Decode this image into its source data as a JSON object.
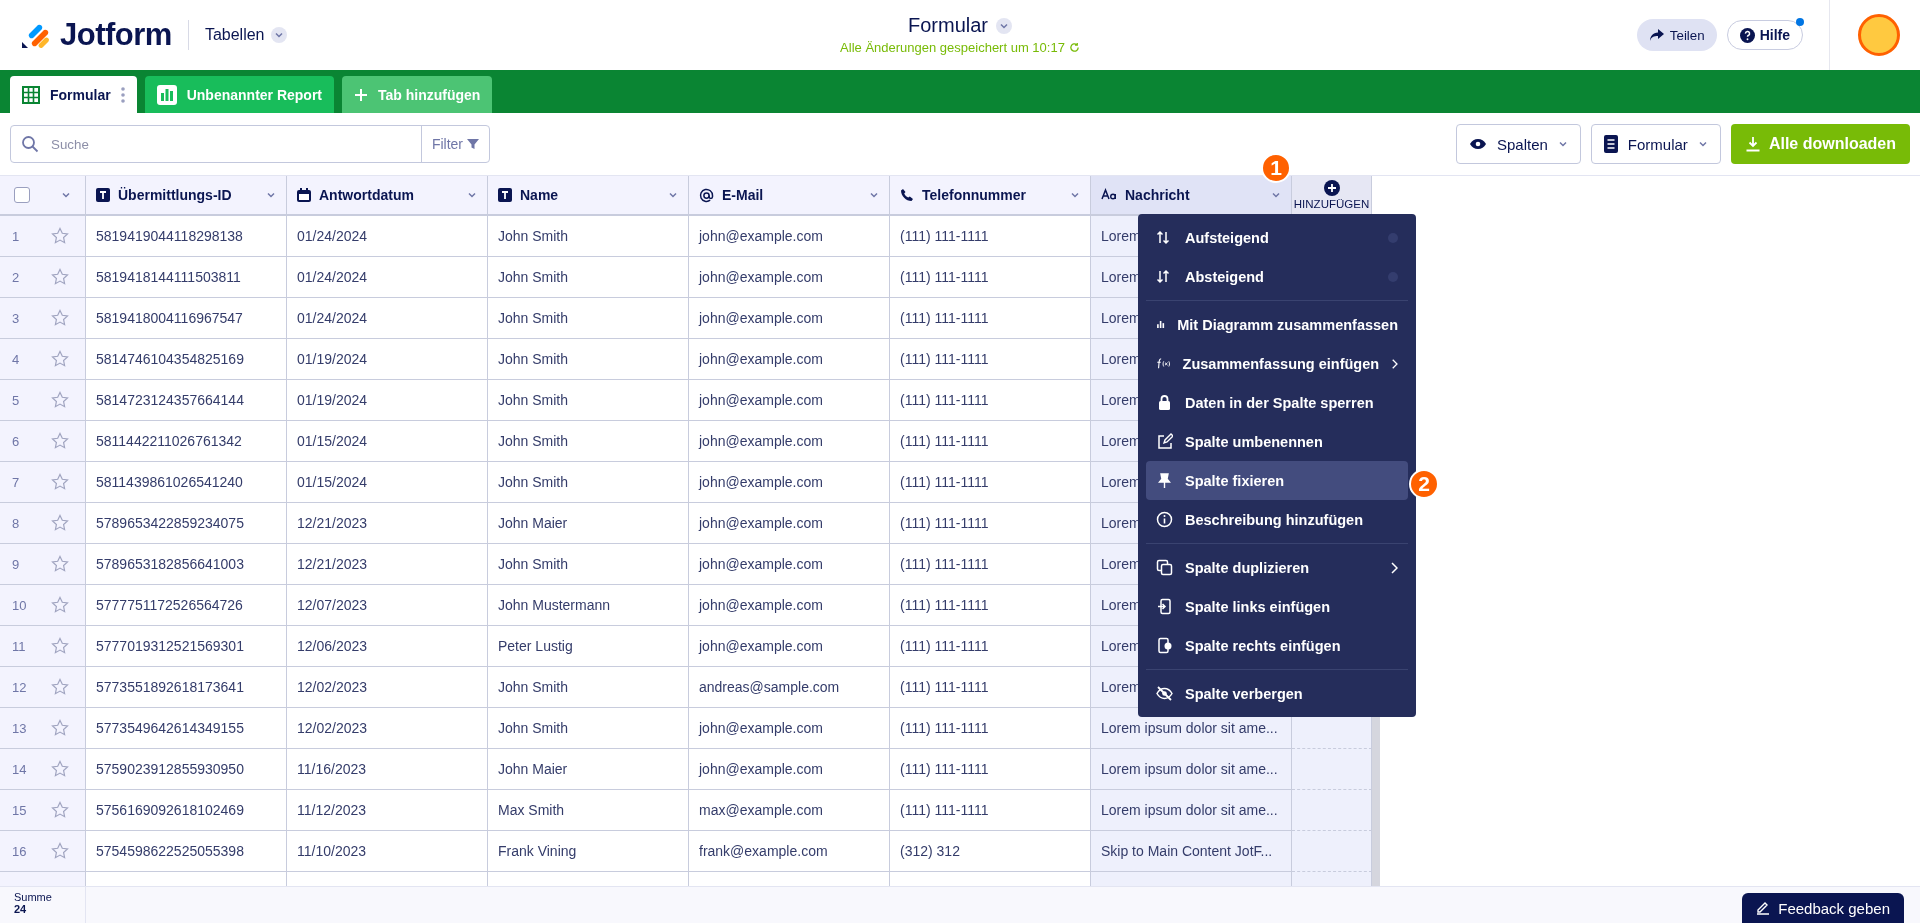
{
  "header": {
    "logo": "Jotform",
    "section": "Tabellen",
    "title": "Formular",
    "status": "Alle Änderungen gespeichert um 10:17",
    "share": "Teilen",
    "help": "Hilfe",
    "help_notification": true
  },
  "tabs": [
    {
      "label": "Formular",
      "kind": "table",
      "selected": true
    },
    {
      "label": "Unbenannter Report",
      "kind": "report",
      "selected": false
    }
  ],
  "add_tab": "Tab hinzufügen",
  "toolbar": {
    "search": {
      "placeholder": "Suche"
    },
    "filter": "Filter",
    "columns_button": "Spalten",
    "form_button": "Formular",
    "download_button": "Alle downloaden"
  },
  "table": {
    "all_checked": false,
    "columns": [
      {
        "label": "Übermittlungs-ID",
        "kind": "text",
        "selected": false
      },
      {
        "label": "Antwortdatum",
        "kind": "date",
        "selected": false
      },
      {
        "label": "Name",
        "kind": "text",
        "selected": false
      },
      {
        "label": "E-Mail",
        "kind": "email",
        "selected": false
      },
      {
        "label": "Telefonnummer",
        "kind": "phone",
        "selected": false
      },
      {
        "label": "Nachricht",
        "kind": "longtext",
        "selected": true
      }
    ],
    "add_column": "HINZUFÜGEN",
    "rows": [
      {
        "number": "1",
        "starred": false,
        "cells": [
          "5819419044118298138",
          "01/24/2024",
          "John Smith",
          "john@example.com",
          "(111) 111-1111",
          "Lorem"
        ]
      },
      {
        "number": "2",
        "starred": false,
        "cells": [
          "5819418144111503811",
          "01/24/2024",
          "John Smith",
          "john@example.com",
          "(111) 111-1111",
          "Lorem"
        ]
      },
      {
        "number": "3",
        "starred": false,
        "cells": [
          "5819418004116967547",
          "01/24/2024",
          "John Smith",
          "john@example.com",
          "(111) 111-1111",
          "Lorem"
        ]
      },
      {
        "number": "4",
        "starred": false,
        "cells": [
          "5814746104354825169",
          "01/19/2024",
          "John Smith",
          "john@example.com",
          "(111) 111-1111",
          "Lorem"
        ]
      },
      {
        "number": "5",
        "starred": false,
        "cells": [
          "5814723124357664144",
          "01/19/2024",
          "John Smith",
          "john@example.com",
          "(111) 111-1111",
          "Lorem"
        ]
      },
      {
        "number": "6",
        "starred": false,
        "cells": [
          "5811442211026761342",
          "01/15/2024",
          "John Smith",
          "john@example.com",
          "(111) 111-1111",
          "Lorem"
        ]
      },
      {
        "number": "7",
        "starred": false,
        "cells": [
          "5811439861026541240",
          "01/15/2024",
          "John Smith",
          "john@example.com",
          "(111) 111-1111",
          "Lorem"
        ]
      },
      {
        "number": "8",
        "starred": false,
        "cells": [
          "5789653422859234075",
          "12/21/2023",
          "John Maier",
          "john@example.com",
          "(111) 111-1111",
          "Lorem"
        ]
      },
      {
        "number": "9",
        "starred": false,
        "cells": [
          "5789653182856641003",
          "12/21/2023",
          "John Smith",
          "john@example.com",
          "(111) 111-1111",
          "Lorem"
        ]
      },
      {
        "number": "10",
        "starred": false,
        "cells": [
          "5777751172526564726",
          "12/07/2023",
          "John Mustermann",
          "john@example.com",
          "(111) 111-1111",
          "Lorem"
        ]
      },
      {
        "number": "11",
        "starred": false,
        "cells": [
          "5777019312521569301",
          "12/06/2023",
          "Peter Lustig",
          "john@example.com",
          "(111) 111-1111",
          "Lorem"
        ]
      },
      {
        "number": "12",
        "starred": false,
        "cells": [
          "5773551892618173641",
          "12/02/2023",
          "John Smith",
          "andreas@sample.com",
          "(111) 111-1111",
          "Lorem"
        ]
      },
      {
        "number": "13",
        "starred": false,
        "cells": [
          "5773549642614349155",
          "12/02/2023",
          "John Smith",
          "john@example.com",
          "(111) 111-1111",
          "Lorem ipsum dolor sit ame..."
        ]
      },
      {
        "number": "14",
        "starred": false,
        "cells": [
          "5759023912855930950",
          "11/16/2023",
          "John Maier",
          "john@example.com",
          "(111) 111-1111",
          "Lorem ipsum dolor sit ame..."
        ]
      },
      {
        "number": "15",
        "starred": false,
        "cells": [
          "5756169092618102469",
          "11/12/2023",
          "Max Smith",
          "max@example.com",
          "(111) 111-1111",
          "Lorem ipsum dolor sit ame..."
        ]
      },
      {
        "number": "16",
        "starred": false,
        "cells": [
          "5754598622525055398",
          "11/10/2023",
          "Frank Vining",
          "frank@example.com",
          "(312) 312",
          "Skip to Main Content JotF..."
        ]
      }
    ]
  },
  "column_menu": {
    "groups": [
      [
        {
          "label": "Aufsteigend",
          "kind": "sort",
          "selected": false
        },
        {
          "label": "Absteigend",
          "kind": "sort",
          "selected": false
        }
      ],
      [
        {
          "label": "Mit Diagramm zusammenfassen",
          "kind": "action",
          "selected": false
        },
        {
          "label": "Zusammenfassung einfügen",
          "kind": "submenu",
          "selected": false
        },
        {
          "label": "Daten in der Spalte sperren",
          "kind": "action",
          "selected": false
        },
        {
          "label": "Spalte umbenennen",
          "kind": "action",
          "selected": false
        },
        {
          "label": "Spalte fixieren",
          "kind": "action",
          "selected": true
        },
        {
          "label": "Beschreibung hinzufügen",
          "kind": "action",
          "selected": false
        }
      ],
      [
        {
          "label": "Spalte duplizieren",
          "kind": "submenu",
          "selected": false
        },
        {
          "label": "Spalte links einfügen",
          "kind": "action",
          "selected": false
        },
        {
          "label": "Spalte rechts einfügen",
          "kind": "action",
          "selected": false
        }
      ],
      [
        {
          "label": "Spalte verbergen",
          "kind": "action",
          "selected": false
        }
      ]
    ]
  },
  "callouts": [
    {
      "label": "1"
    },
    {
      "label": "2"
    }
  ],
  "footer": {
    "label": "Summe",
    "value": "24",
    "feedback": "Feedback geben"
  }
}
